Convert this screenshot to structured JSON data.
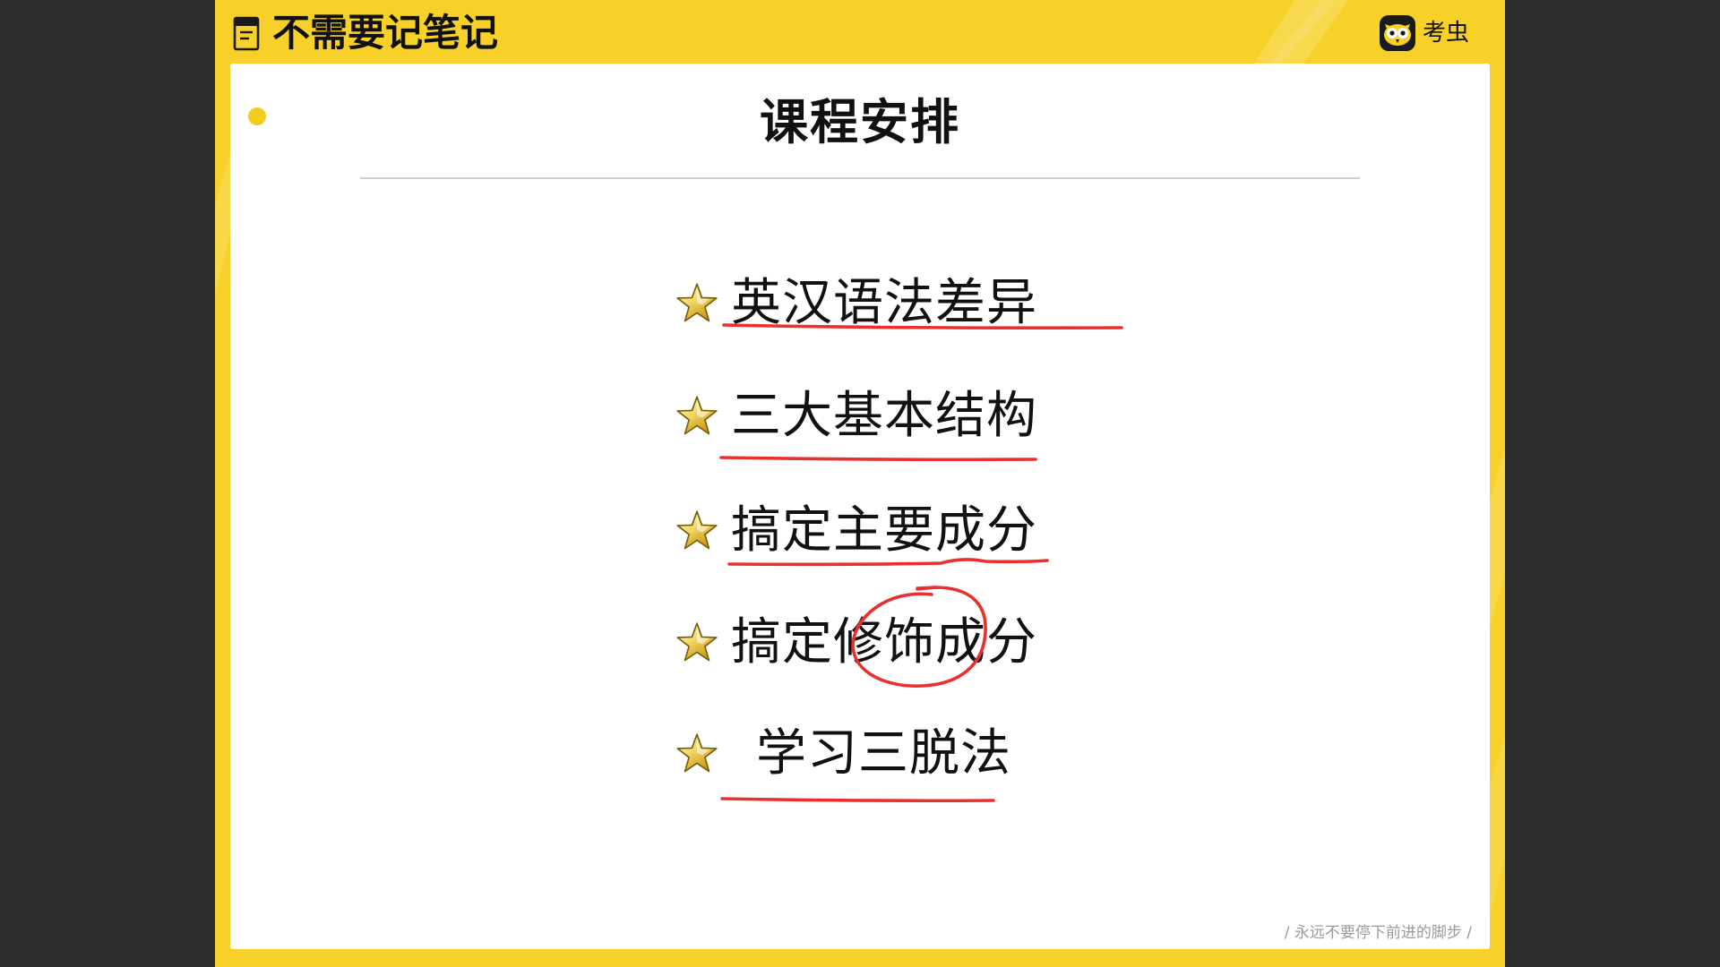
{
  "header": {
    "title": "不需要记笔记",
    "brand": "考虫"
  },
  "slide": {
    "title": "课程安排",
    "items": [
      {
        "label": "英汉语法差异"
      },
      {
        "label": "三大基本结构"
      },
      {
        "label": "搞定主要成分"
      },
      {
        "label": "搞定修饰成分"
      },
      {
        "label": "学习三脱法"
      }
    ],
    "footer": "/ 永远不要停下前进的脚步 /"
  },
  "icons": {
    "header": "notebook-icon",
    "brand": "kaochong-owl-logo-icon",
    "bullet": "star-icon"
  },
  "colors": {
    "background": "#2e2e2e",
    "brand_yellow": "#f7d12a",
    "card": "#ffffff",
    "accent_dot": "#f2cc1f",
    "annotation_red": "#e8302f",
    "footer_text": "#9a9a9a"
  }
}
